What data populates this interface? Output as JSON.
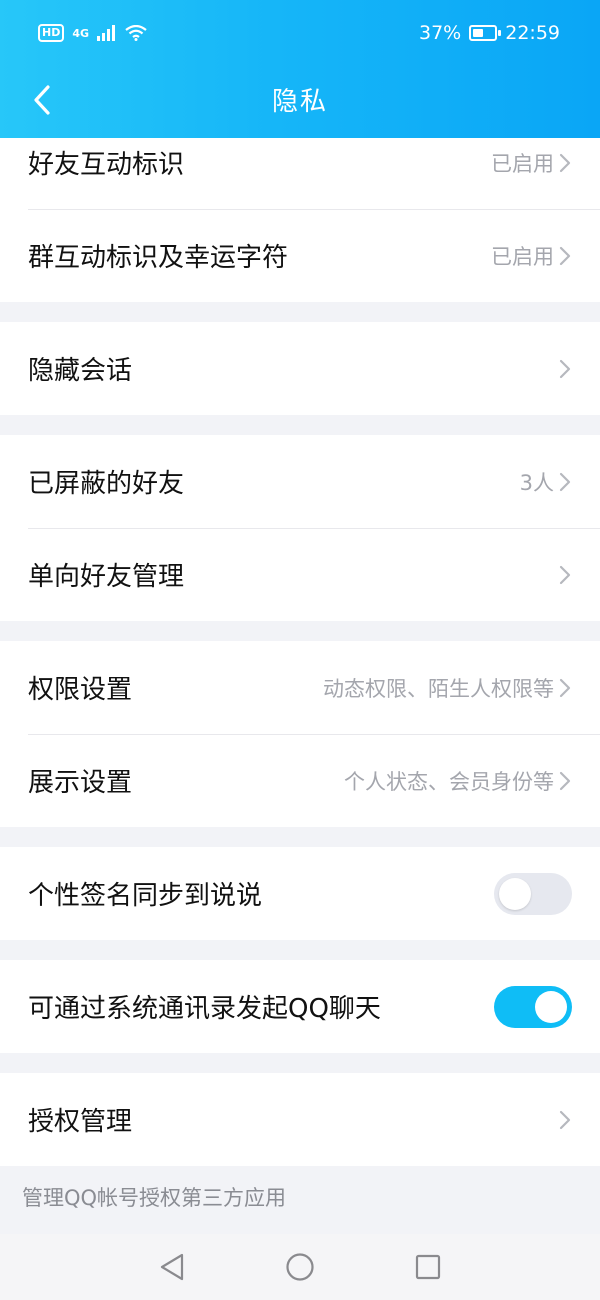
{
  "status_bar": {
    "network": "4G",
    "battery": "37%",
    "time": "22:59"
  },
  "header": {
    "title": "隐私"
  },
  "groups": [
    [
      {
        "label": "好友互动标识",
        "value": "已启用"
      },
      {
        "label": "群互动标识及幸运字符",
        "value": "已启用"
      }
    ],
    [
      {
        "label": "隐藏会话",
        "value": ""
      }
    ],
    [
      {
        "label": "已屏蔽的好友",
        "value": "3人"
      },
      {
        "label": "单向好友管理",
        "value": ""
      }
    ],
    [
      {
        "label": "权限设置",
        "value": "动态权限、陌生人权限等"
      },
      {
        "label": "展示设置",
        "value": "个人状态、会员身份等"
      }
    ],
    [
      {
        "label": "个性签名同步到说说",
        "toggle": false
      }
    ],
    [
      {
        "label": "可通过系统通讯录发起QQ聊天",
        "toggle": true
      }
    ],
    [
      {
        "label": "授权管理",
        "value": ""
      }
    ]
  ],
  "footer_note": "管理QQ帐号授权第三方应用",
  "colors": {
    "accent": "#0fbdf6",
    "header_gradient_start": "#27c7f9",
    "header_gradient_end": "#0aa6f6"
  },
  "icons": {
    "back": "chevron-left-icon",
    "row_arrow": "chevron-right-icon",
    "sys_back": "triangle-back-icon",
    "sys_home": "circle-home-icon",
    "sys_recent": "square-recent-icon"
  }
}
